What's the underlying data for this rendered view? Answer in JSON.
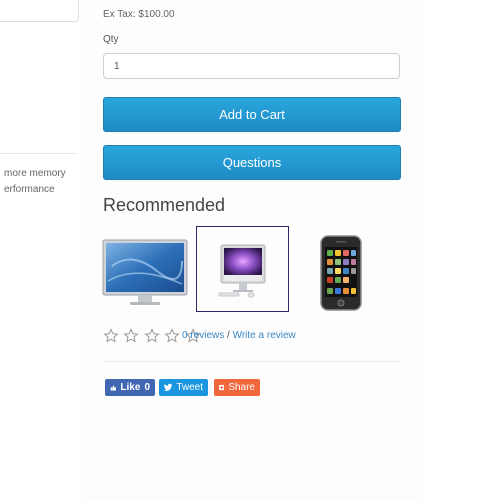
{
  "left_sidebar": {
    "text_line_1": "more memory",
    "text_line_2": "erformance"
  },
  "product": {
    "ex_tax": "Ex Tax: $100.00",
    "qty_label": "Qty",
    "qty_value": "1",
    "add_to_cart_label": "Add to Cart",
    "questions_label": "Questions"
  },
  "recommended": {
    "heading": "Recommended",
    "items": [
      {
        "icon": "apple-cinema-display-image"
      },
      {
        "icon": "imac-image"
      },
      {
        "icon": "iphone-image"
      }
    ]
  },
  "rating": {
    "stars_filled": 0,
    "stars_total": 5,
    "reviews_link": "0 reviews",
    "separator": " / ",
    "write_review_link": "Write a review"
  },
  "social": {
    "like_label": "Like",
    "like_count": "0",
    "tweet_label": "Tweet",
    "share_label": "Share"
  },
  "colors": {
    "button_blue": "#1f8cc6",
    "link_blue": "#3a88c3",
    "facebook": "#4267b2",
    "twitter": "#1b95e0",
    "share": "#f0673b"
  }
}
